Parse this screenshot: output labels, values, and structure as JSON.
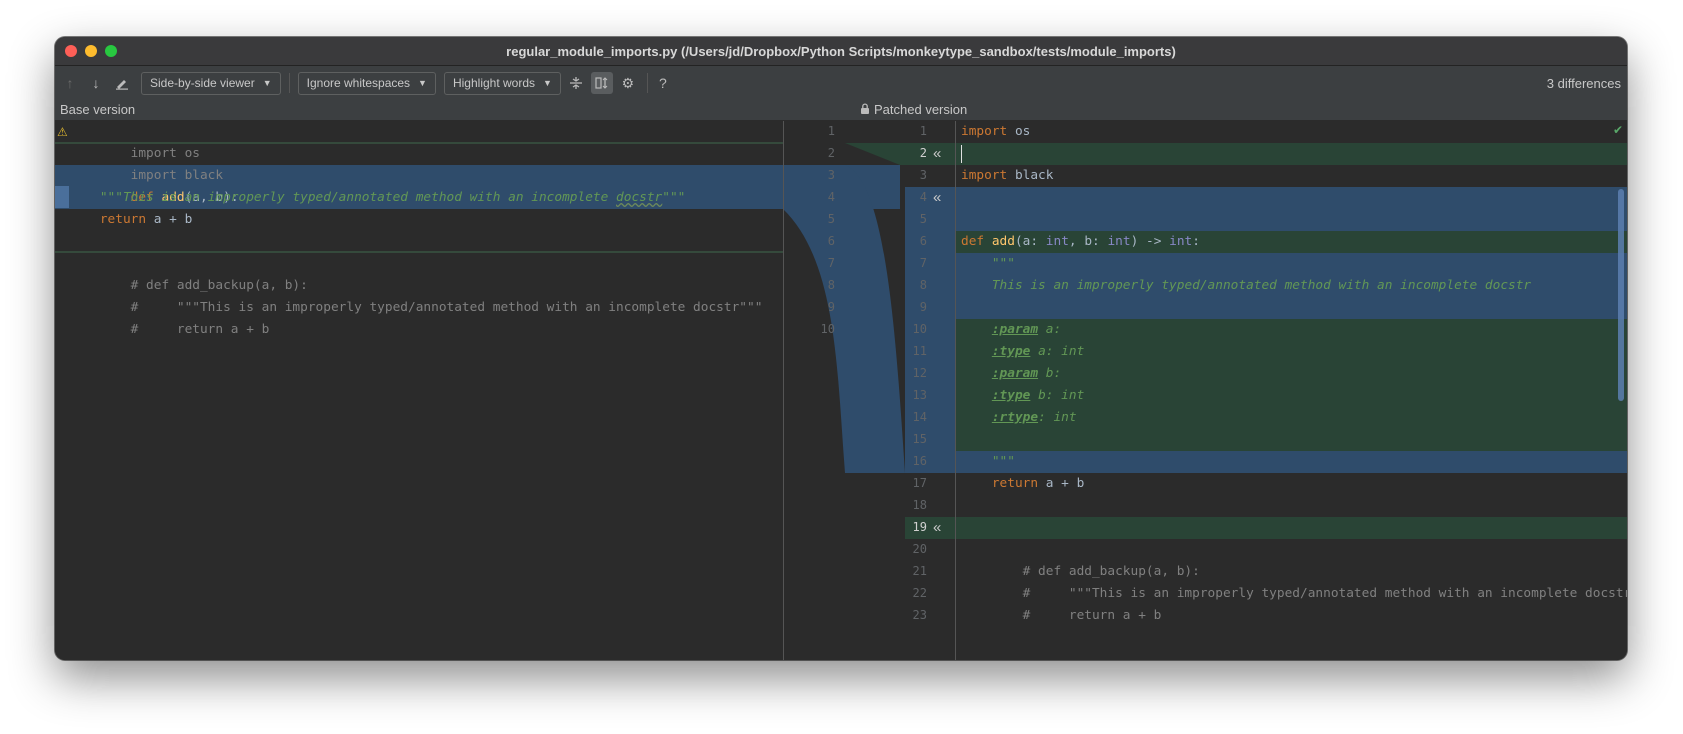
{
  "window": {
    "title": "regular_module_imports.py (/Users/jd/Dropbox/Python Scripts/monkeytype_sandbox/tests/module_imports)"
  },
  "toolbar": {
    "viewer_label": "Side-by-side viewer",
    "whitespace_label": "Ignore whitespaces",
    "highlight_label": "Highlight words",
    "help_label": "?",
    "differences_label": "3 differences"
  },
  "panes": {
    "base_label": "Base version",
    "patched_label": "Patched version"
  },
  "colors": {
    "added": "#294436",
    "modified": "#2f4c6b",
    "modified_dark": "#3b5f87",
    "keyword": "#cc7832",
    "function": "#ffc66d",
    "docstring": "#629755",
    "comment": "#808080"
  },
  "left_lines": [
    "import os",
    "import black",
    "def add(a, b):",
    "    \"\"\"This is an improperly typed/annotated method with an incomplete docstr\"\"\"",
    "    return a + b",
    "",
    "# def add_backup(a, b):",
    "#     \"\"\"This is an improperly typed/annotated method with an incomplete docstr\"\"\"",
    "#     return a + b"
  ],
  "left_numbers": [
    "1",
    "2",
    "3",
    "4",
    "5",
    "6",
    "7",
    "8",
    "9",
    "10"
  ],
  "right_numbers": [
    "1",
    "2",
    "3",
    "4",
    "5",
    "6",
    "7",
    "8",
    "9",
    "10",
    "11",
    "12",
    "13",
    "14",
    "15",
    "16",
    "17",
    "18",
    "19",
    "20",
    "21",
    "22",
    "23"
  ],
  "right_lines": [
    "import os",
    "",
    "import black",
    "",
    "",
    "def add(a: int, b: int) -> int:",
    "    \"\"\"",
    "    This is an improperly typed/annotated method with an incomplete docstr",
    "",
    "    :param a:",
    "    :type a: int",
    "    :param b:",
    "    :type b: int",
    "    :rtype: int",
    "",
    "    \"\"\"",
    "    return a + b",
    "",
    "",
    "# def add_backup(a, b):",
    "#     \"\"\"This is an improperly typed/annotated method with an incomplete docstr\"\"\"",
    "#     return a + b",
    ""
  ]
}
